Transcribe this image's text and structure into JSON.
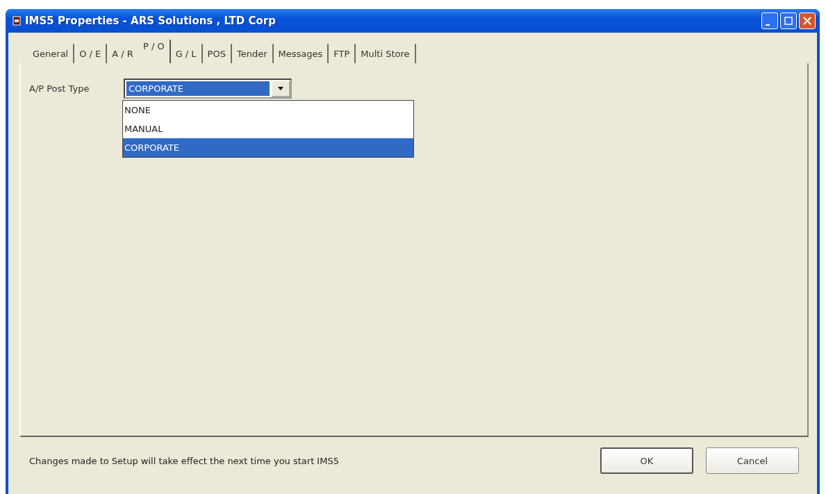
{
  "window": {
    "title": "IMS5 Properties - ARS Solutions , LTD Corp"
  },
  "tabs": [
    {
      "label": "General",
      "selected": false
    },
    {
      "label": "O / E",
      "selected": false
    },
    {
      "label": "A / R",
      "selected": false
    },
    {
      "label": "P / O",
      "selected": true
    },
    {
      "label": "G / L",
      "selected": false
    },
    {
      "label": "POS",
      "selected": false
    },
    {
      "label": "Tender",
      "selected": false
    },
    {
      "label": "Messages",
      "selected": false
    },
    {
      "label": "FTP",
      "selected": false
    },
    {
      "label": "Multi Store",
      "selected": false
    }
  ],
  "ap_post_type": {
    "label": "A/P Post Type",
    "value": "CORPORATE",
    "expanded": true,
    "options": [
      {
        "label": "NONE",
        "selected": false
      },
      {
        "label": "MANUAL",
        "selected": false
      },
      {
        "label": "CORPORATE",
        "selected": true
      }
    ]
  },
  "status_text": "Changes made to Setup will take effect the next time you start IMS5",
  "buttons": [
    "OK",
    "Cancel"
  ]
}
